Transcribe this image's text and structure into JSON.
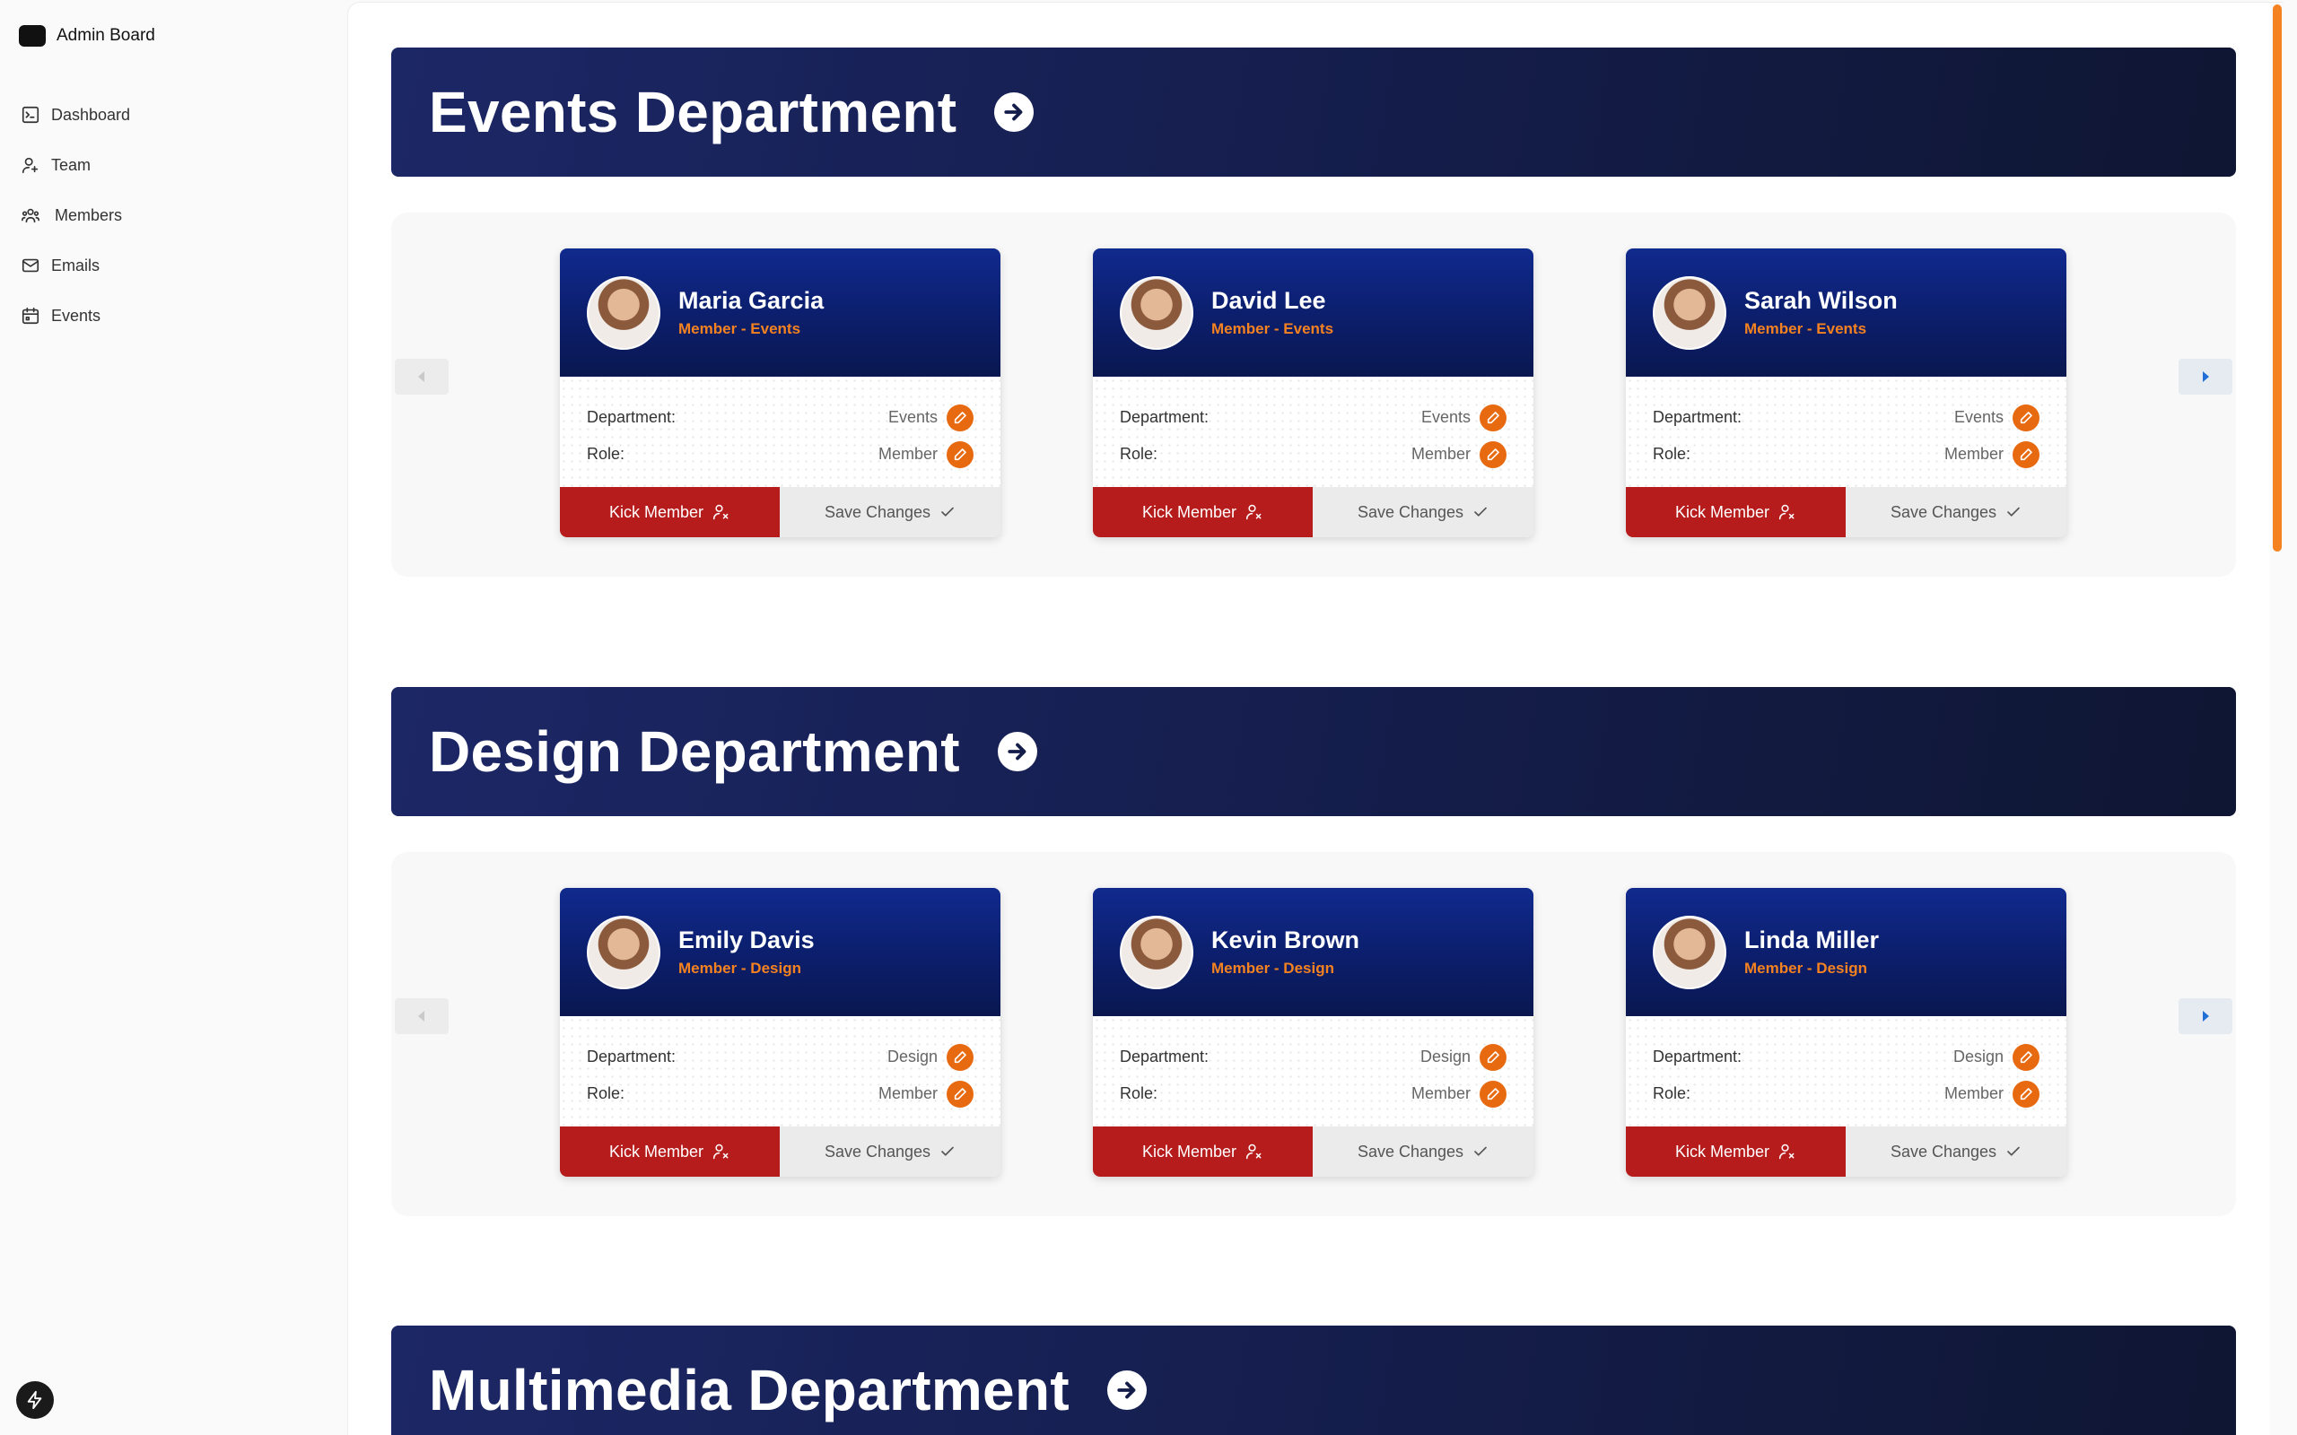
{
  "app": {
    "title": "Admin Board"
  },
  "sidebar": {
    "items": [
      {
        "label": "Dashboard",
        "icon": "terminal-icon"
      },
      {
        "label": "Team",
        "icon": "user-plus-icon"
      },
      {
        "label": "Members",
        "icon": "users-icon"
      },
      {
        "label": "Emails",
        "icon": "mail-icon"
      },
      {
        "label": "Events",
        "icon": "calendar-icon"
      }
    ]
  },
  "card_labels": {
    "department": "Department:",
    "role": "Role:",
    "kick": "Kick Member",
    "save": "Save Changes"
  },
  "departments": [
    {
      "title": "Events Department",
      "members": [
        {
          "name": "Maria Garcia",
          "subtitle": "Member - Events",
          "department": "Events",
          "role": "Member"
        },
        {
          "name": "David Lee",
          "subtitle": "Member - Events",
          "department": "Events",
          "role": "Member"
        },
        {
          "name": "Sarah Wilson",
          "subtitle": "Member - Events",
          "department": "Events",
          "role": "Member"
        }
      ]
    },
    {
      "title": "Design Department",
      "members": [
        {
          "name": "Emily Davis",
          "subtitle": "Member - Design",
          "department": "Design",
          "role": "Member"
        },
        {
          "name": "Kevin Brown",
          "subtitle": "Member - Design",
          "department": "Design",
          "role": "Member"
        },
        {
          "name": "Linda Miller",
          "subtitle": "Member - Design",
          "department": "Design",
          "role": "Member"
        }
      ]
    },
    {
      "title": "Multimedia Department",
      "members": []
    }
  ],
  "colors": {
    "banner": "#141d4a",
    "card_header": "#0c1f6e",
    "accent_orange": "#f58220",
    "kick_red": "#b71c1c"
  }
}
